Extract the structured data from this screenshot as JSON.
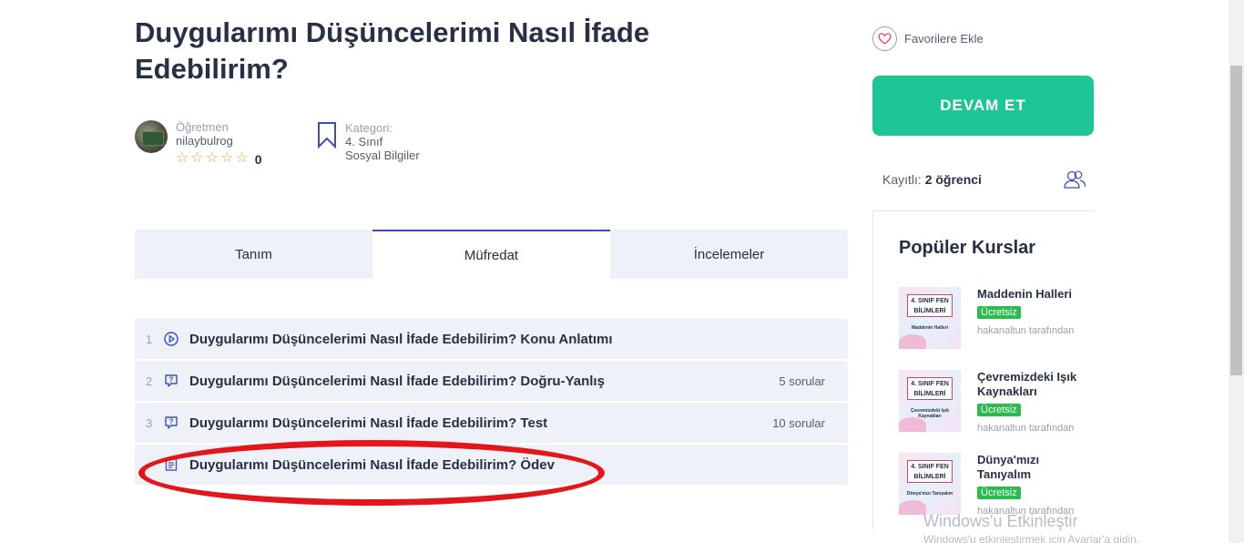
{
  "course": {
    "title": "Duygularımı Düşüncelerimi Nasıl İfade Edebilirim?"
  },
  "teacher": {
    "label": "Öğretmen",
    "name": "nilaybulrog",
    "rating_count": "0"
  },
  "category": {
    "label": "Kategori:",
    "line1": "4. Sınıf",
    "line2": "Sosyal Bilgiler"
  },
  "tabs": [
    {
      "label": "Tanım"
    },
    {
      "label": "Müfredat"
    },
    {
      "label": "İncelemeler"
    }
  ],
  "curriculum": [
    {
      "num": "1",
      "icon": "play-circle-icon",
      "title": "Duygularımı Düşüncelerimi Nasıl İfade Edebilirim? Konu Anlatımı",
      "meta": ""
    },
    {
      "num": "2",
      "icon": "quiz-icon",
      "title": "Duygularımı Düşüncelerimi Nasıl İfade Edebilirim? Doğru-Yanlış",
      "meta": "5 sorular"
    },
    {
      "num": "3",
      "icon": "quiz-icon",
      "title": "Duygularımı Düşüncelerimi Nasıl İfade Edebilirim? Test",
      "meta": "10 sorular"
    },
    {
      "num": "",
      "icon": "assignment-icon",
      "title": "Duygularımı Düşüncelerimi Nasıl İfade Edebilirim? Ödev",
      "meta": ""
    }
  ],
  "sidebar": {
    "favorite_label": "Favorilere Ekle",
    "continue_label": "DEVAM ET",
    "enrolled_label": "Kayıtlı:",
    "enrolled_value": "2 öğrenci",
    "popular_title": "Popüler Kurslar",
    "popular_courses": [
      {
        "title": "Maddenin Halleri",
        "price": "Ücretsiz",
        "author": "hakanaltun tarafından",
        "thumb_badge": "4. SINIF FEN BİLİMLERİ",
        "thumb_sub": "Maddenin Halleri"
      },
      {
        "title": "Çevremizdeki Işık Kaynakları",
        "price": "Ücretsiz",
        "author": "hakanaltun tarafından",
        "thumb_badge": "4. SINIF FEN BİLİMLERİ",
        "thumb_sub": "Çevremizdeki Işık Kaynakları"
      },
      {
        "title": "Dünya'mızı Tanıyalım",
        "price": "Ücretsiz",
        "author": "hakanaltun tarafından",
        "thumb_badge": "4. SINIF FEN BİLİMLERİ",
        "thumb_sub": "Dünya'mızı Tanıyalım"
      }
    ]
  },
  "watermark": {
    "line1": "Windows'u Etkinleştir",
    "line2": "Windows'u etkinleştirmek için Ayarlar'a gidin."
  },
  "colors": {
    "accent_green": "#1ec695",
    "tab_active_border": "#3c4fb6",
    "highlight_red": "#e3161b",
    "badge_green": "#2bbb4f"
  }
}
